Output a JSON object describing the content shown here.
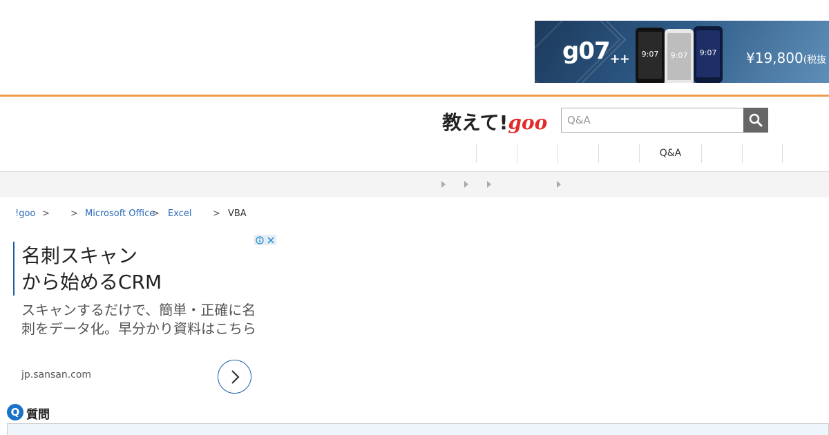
{
  "banner": {
    "brand": "g07",
    "brand_suffix": "++",
    "phone_time": "9:07",
    "price": "¥19,800",
    "price_note": "(税抜"
  },
  "header": {
    "logo_ja": "教えて!",
    "logo_goo": "goo"
  },
  "search": {
    "placeholder": "Q&A"
  },
  "nav": {
    "items": [
      "",
      "",
      "",
      "",
      "Q&A",
      "",
      ""
    ]
  },
  "breadcrumb": {
    "items": [
      {
        "label": "!goo",
        "link": true
      },
      {
        "label": "",
        "link": true
      },
      {
        "label": "Microsoft Office",
        "link": true
      },
      {
        "label": "Excel",
        "link": true
      },
      {
        "label": "VBA",
        "link": false
      }
    ]
  },
  "ad": {
    "title_line1": "名刺スキャン",
    "title_line2": "から始めるCRM",
    "description": "スキャンするだけで、簡単・正確に名刺をデータ化。早分かり資料はこちら",
    "url": "jp.sansan.com",
    "info_symbol": "ⓘ",
    "close_symbol": "✕"
  },
  "question": {
    "badge": "Q",
    "label": "質問"
  },
  "colors": {
    "accent_orange": "#ef9a4d",
    "link_blue": "#2a6ab8",
    "ad_blue": "#1a5ea8",
    "q_badge_blue": "#1a73c9",
    "goo_red": "#e22b2b"
  }
}
